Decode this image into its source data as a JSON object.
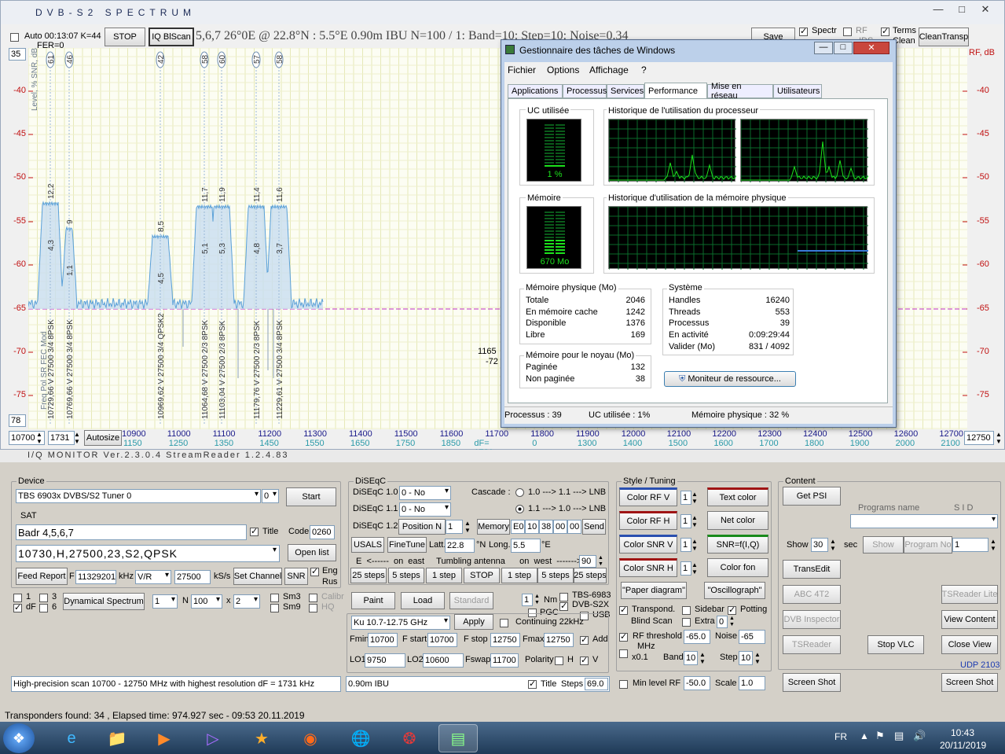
{
  "spectrum_window": {
    "title": "DVB-S2   SPECTRUM",
    "toolbar": {
      "auto_label": "Auto 00:13:07  K=44",
      "fer_label": "FER=0",
      "stop_button": "STOP",
      "iqblscan_button": "IQ BlScan",
      "info": "5,6,7   26°0E @ 22.8°N : 5.5°E   0.90m IBU   N=100 / 1: Band=10: Step=10: Noise=0.34",
      "save_button": "Save",
      "spectr_label": "Spectr",
      "rf_label": "RF",
      "terms_label": "Terms",
      "ids_label": "IDS",
      "clean_label": "Clean",
      "cleantransp_button": "CleanTransp"
    },
    "top_value": "35",
    "bottom_value": "78",
    "left_axis_title": "Level, %   SNR, dB",
    "right_axis_title": "RF, dB",
    "y_labels": [
      "-40",
      "-45",
      "-50",
      "-55",
      "-60",
      "-65",
      "-70",
      "-75"
    ],
    "freq_start": "10700",
    "df_value": "1731",
    "autosize_button": "Autosize",
    "freq_end": "12750",
    "x_labels_top": [
      "10900",
      "11000",
      "11100",
      "11200",
      "11300",
      "11400",
      "11500",
      "11600",
      "11700",
      "11800",
      "11900",
      "12000",
      "12100",
      "12200",
      "12300",
      "12400",
      "12500",
      "12600",
      "12700"
    ],
    "x_labels_bottom": [
      "1150",
      "1250",
      "1350",
      "1450",
      "1550",
      "1650",
      "1750",
      "1850",
      "dF= 1731 kHz",
      "0",
      "1300",
      "1400",
      "1500",
      "1600",
      "1700",
      "1800",
      "1900",
      "2000",
      "2100"
    ],
    "param_header": "Freq  Pol  SR  FEC  Mod",
    "peaks": [
      {
        "top": "61",
        "snr": "12,2",
        "lvl": "4,3",
        "info": "10729,66  V  27500 3/4  8PSK"
      },
      {
        "top": "46",
        "snr": "9",
        "lvl": "1,1",
        "info": "10769,66  V  27500 3/4  8PSK"
      },
      {
        "top": "42",
        "snr": "8,5",
        "lvl": "4,5",
        "info": "10969,62  V  27500 3/4  QPSK2"
      },
      {
        "top": "58",
        "snr": "11,7",
        "lvl": "5,1",
        "info": "11064,68  V  27500 2/3  8PSK"
      },
      {
        "top": "60",
        "snr": "11,9",
        "lvl": "5,3",
        "info": "11103,04  V  27500 2/3  8PSK"
      },
      {
        "top": "57",
        "snr": "11,4",
        "lvl": "4,8",
        "info": "11179,76  V  27500 2/3  8PSK"
      },
      {
        "top": "58",
        "snr": "11,6",
        "lvl": "3,7",
        "info": "11229,61  V  27500 3/4  8PSK"
      }
    ],
    "cursor_readout": [
      "1165",
      "-72"
    ]
  },
  "task_manager": {
    "title": "Gestionnaire des tâches de Windows",
    "menu": [
      "Fichier",
      "Options",
      "Affichage",
      "?"
    ],
    "tabs": [
      "Applications",
      "Processus",
      "Services",
      "Performance",
      "Mise en réseau",
      "Utilisateurs"
    ],
    "cpu_label": "UC utilisée",
    "cpu_value": "1 %",
    "cpu_history_label": "Historique de l'utilisation du processeur",
    "mem_label": "Mémoire",
    "mem_value": "670 Mo",
    "mem_history_label": "Historique d'utilisation de la mémoire physique",
    "phys_title": "Mémoire physique (Mo)",
    "phys": [
      [
        "Totale",
        "2046"
      ],
      [
        "En mémoire cache",
        "1242"
      ],
      [
        "Disponible",
        "1376"
      ],
      [
        "Libre",
        "169"
      ]
    ],
    "sys_title": "Système",
    "sys": [
      [
        "Handles",
        "16240"
      ],
      [
        "Threads",
        "553"
      ],
      [
        "Processus",
        "39"
      ],
      [
        "En activité",
        "0:09:29:44"
      ],
      [
        "Valider (Mo)",
        "831 / 4092"
      ]
    ],
    "kernel_title": "Mémoire pour le noyau (Mo)",
    "kernel": [
      [
        "Paginée",
        "132"
      ],
      [
        "Non paginée",
        "38"
      ]
    ],
    "resmon_button": "Moniteur de ressource...",
    "status": [
      "Processus : 39",
      "UC utilisée : 1%",
      "Mémoire physique : 32 %"
    ]
  },
  "iq_monitor": {
    "title": "I/Q  MONITOR   Ver.2.3.0.4  StreamReader 1.2.4.83",
    "device_label": "Device",
    "device_value": "TBS 6903x DVBS/S2 Tuner 0",
    "device_index": "0",
    "start_button": "Start",
    "sat_label": "SAT",
    "sat_name": "Badr 4,5,6,7",
    "title_label": "Title",
    "code_label": "Code",
    "code_value": "0260",
    "tp_value": "10730,H,27500,23,S2,QPSK",
    "openlist_button": "Open list",
    "feedreport_button": "Feed Report",
    "f_label": "F",
    "f_value": "11329201",
    "khz_label": "kHz",
    "pol_value": "V/R",
    "sr_value": "27500",
    "ksps_label": "kS/s",
    "setchannel_button": "Set Channel",
    "snr_button": "SNR",
    "eng_label": "Eng",
    "rus_label": "Rus",
    "chk_1": "1",
    "chk_3": "3",
    "chk_df": "dF",
    "chk_6": "6",
    "dynspec_button": "Dynamical  Spectrum",
    "dyn_val1": "1",
    "n_label": "N",
    "n_value": "100",
    "x_label": "x",
    "x_value": "2",
    "sm3_label": "Sm3",
    "sm9_label": "Sm9",
    "calibr_label": "Calibr",
    "hq_label": "HQ",
    "message": "High-precision  scan  10700 - 12750 MHz  with highest resolution dF = 1731 kHz",
    "diseqc_label": "DiSEqC",
    "diseqc10_label": "DiSEqC 1.0",
    "diseqc10_value": "0 - No",
    "diseqc11_label": "DiSEqC 1.1",
    "diseqc11_value": "0 - No",
    "cascade_label": "Cascade :",
    "cascade_opt1": "1.0 ---> 1.1 ---> LNB",
    "cascade_opt2": "1.1 ---> 1.0 ---> LNB",
    "diseqc12_label": "DiSEqC 1.2",
    "position_label": "Position",
    "position_n": "N",
    "position_value": "1",
    "memory_button": "Memory",
    "memory_hex": [
      "E0",
      "10",
      "38",
      "00",
      "00"
    ],
    "send_button": "Send",
    "usals_button": "USALS",
    "finetune_button": "FineTune",
    "latt_label": "Latt.",
    "latt_value": "22.8",
    "latt_dir": "°N",
    "long_label": "Long.",
    "long_value": "5.5",
    "long_dir": "°E",
    "tumbling_label": "E  <------  on  east     Tumbling antenna      on  west  -------> W",
    "tumbling_value": "90",
    "step_buttons": [
      "25 steps",
      "5 steps",
      "1 step",
      "STOP",
      "1 step",
      "5 steps",
      "25 steps"
    ],
    "paint_button": "Paint",
    "load_button": "Load",
    "standard_button": "Standard",
    "nm_value": "1",
    "nm_label": "Nm",
    "pgc_label": "PGC",
    "tbs6983_label": "TBS-6983",
    "dvbs2x_label": "DVB-S2X",
    "usb_label": "USB",
    "band_value": "Ku   10.7-12.75 GHz",
    "apply_button": "Apply",
    "continuing_label": "Continuing 22kHz",
    "fmin_label": "Fmin",
    "fmin_value": "10700",
    "fstart_label": "F start",
    "fstart_value": "10700",
    "fstop_label": "F stop",
    "fstop_value": "12750",
    "fmax_label": "Fmax",
    "fmax_value": "12750",
    "add_label": "Add",
    "lo1_label": "LO1",
    "lo1_value": "9750",
    "lo2_label": "LO2",
    "lo2_value": "10600",
    "fswap_label": "Fswap",
    "fswap_value": "11700",
    "polarity_label": "Polarity",
    "pol_h": "H",
    "pol_v": "V",
    "ant_value": "0.90m IBU",
    "title2_label": "Title",
    "steps_label": "Steps",
    "steps_value": "69.0",
    "style_label": "Style / Tuning",
    "color_rfv": "Color  RF V",
    "color_rfh": "Color  RF H",
    "color_snrv": "Color  SNR V",
    "color_snrh": "Color  SNR H",
    "style_nums": [
      "1",
      "1",
      "1",
      "1"
    ],
    "textcolor_button": "Text color",
    "netcolor_button": "Net color",
    "snrf_button": "SNR=f(I,Q)",
    "colorfon_button": "Color fon",
    "paper_button": "\"Paper diagram\"",
    "oscillo_button": "\"Oscillograph\"",
    "transpond_label": "Transpond.",
    "sidebar_label": "Sidebar",
    "potting_label": "Potting",
    "blindscan_label": "Blind  Scan",
    "extra_label": "Extra",
    "extra_value": "0",
    "rfthreshold_label": "RF threshold",
    "rfthreshold_value": "-65.0",
    "noise_label": "Noise",
    "noise_value": "-65",
    "mhz_label": "MHz",
    "x01_label": "x0.1",
    "band_label": "Band",
    "band_num": "10",
    "step_label": "Step",
    "step_num": "10",
    "minlevel_label": "Min level RF",
    "minlevel_value": "-50.0",
    "scale_label": "Scale",
    "scale_value": "1.0",
    "content_label": "Content",
    "getpsi_button": "Get  PSI",
    "programs_label": "Programs  name",
    "sid_label": "S I D",
    "show_label": "Show",
    "show_value": "30",
    "sec_label": "sec",
    "show_button": "Show",
    "programno_button": "Program  No",
    "program_value": "1",
    "transedit_button": "TransEdit",
    "abc4t2_button": "ABC 4T2",
    "tsreaderlite_button": "TSReader Lite",
    "dvbinspector_button": "DVB Inspector",
    "viewcontent_button": "View Content",
    "tsreader_button": "TSReader",
    "stopvlc_button": "Stop  VLC",
    "closeview_button": "Close View",
    "udp_label": "UDP 2103",
    "screenshot1_button": "Screen Shot",
    "screenshot2_button": "Screen Shot"
  },
  "status_bar": "Transponders found: 34 , Elapsed time: 974.927 sec - 09:53 20.11.2019",
  "taskbar": {
    "lang": "FR",
    "time": "10:43",
    "date": "20/11/2019"
  }
}
